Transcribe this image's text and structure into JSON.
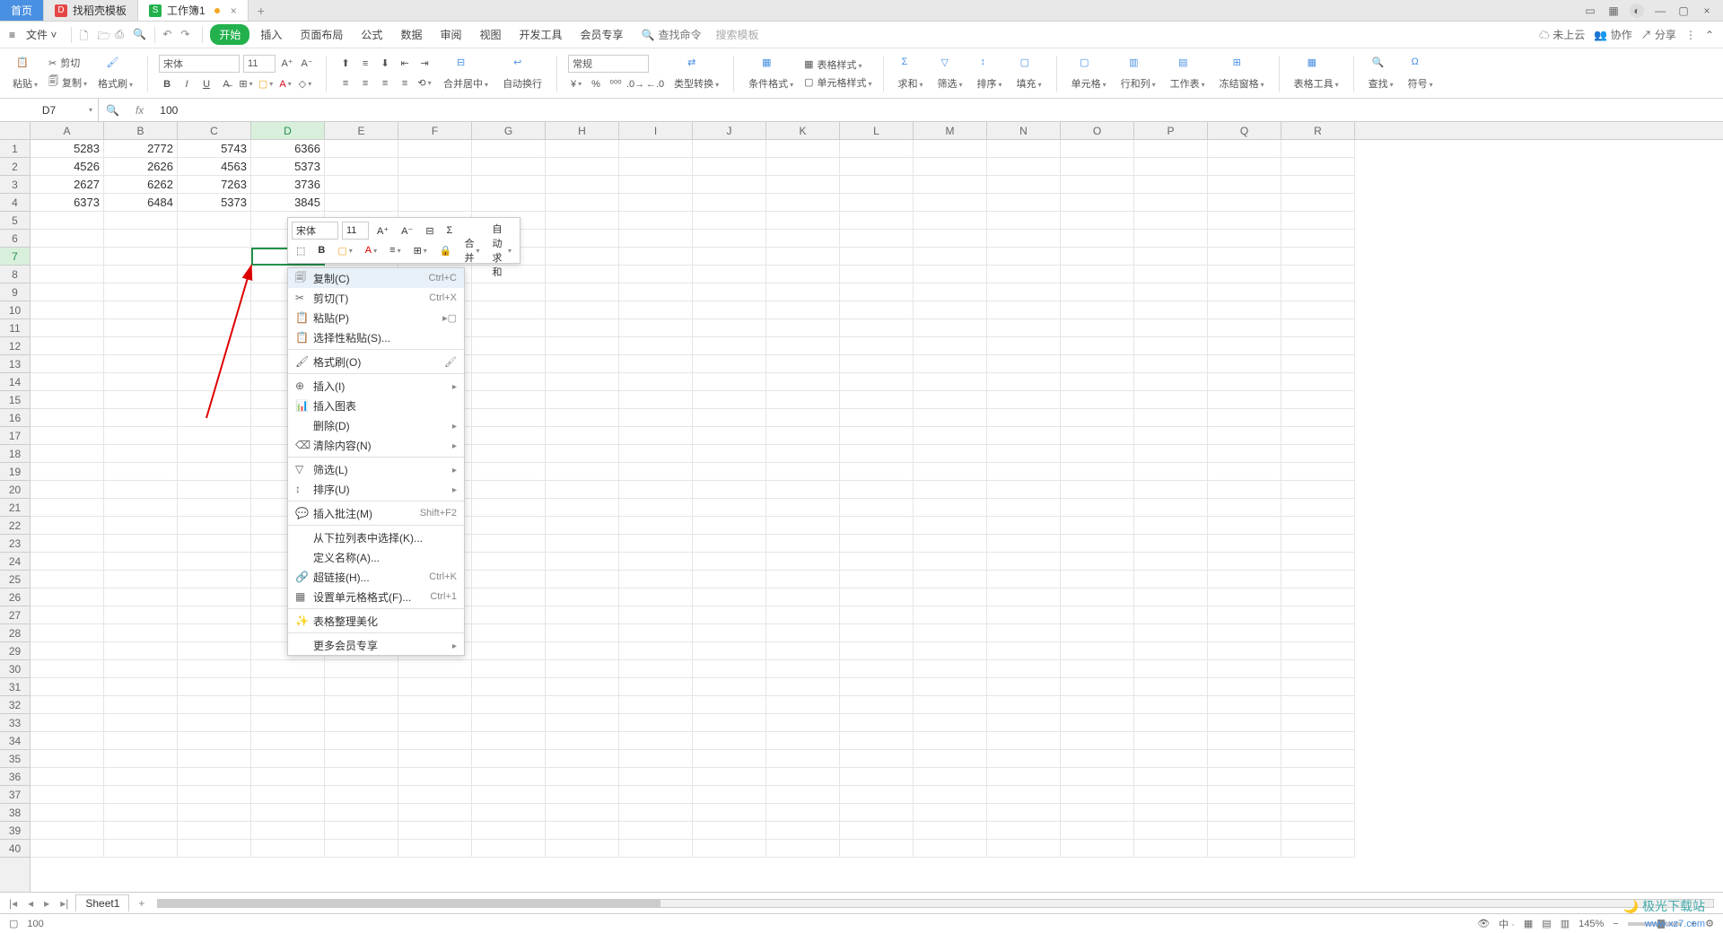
{
  "titlebar": {
    "home_tab": "首页",
    "tab2": "找稻壳模板",
    "tab3": "工作簿1"
  },
  "menubar": {
    "file": "文件",
    "tabs": [
      "开始",
      "插入",
      "页面布局",
      "公式",
      "数据",
      "审阅",
      "视图",
      "开发工具",
      "会员专享"
    ],
    "search_placeholder": "查找命令",
    "search2": "搜索模板",
    "right": {
      "cloud": "未上云",
      "coop": "协作",
      "share": "分享"
    }
  },
  "ribbon": {
    "paste": "粘贴",
    "cut": "剪切",
    "copy": "复制",
    "format_painter": "格式刷",
    "font": "宋体",
    "font_size": "11",
    "merge": "合并居中",
    "wrap": "自动换行",
    "num_fmt": "常规",
    "type_convert": "类型转换",
    "cond_fmt": "条件格式",
    "table_style": "表格样式",
    "cell_style": "单元格样式",
    "sum": "求和",
    "filter": "筛选",
    "sort": "排序",
    "fill": "填充",
    "cell": "单元格",
    "rowcol": "行和列",
    "worksheet": "工作表",
    "freeze": "冻结窗格",
    "table_tool": "表格工具",
    "find": "查找",
    "symbol": "符号"
  },
  "namebox": "D7",
  "formula": "100",
  "columns": [
    "A",
    "B",
    "C",
    "D",
    "E",
    "F",
    "G",
    "H",
    "I",
    "J",
    "K",
    "L",
    "M",
    "N",
    "O",
    "P",
    "Q",
    "R"
  ],
  "chart_data": {
    "type": "table",
    "rows": [
      {
        "A": "5283",
        "B": "2772",
        "C": "5743",
        "D": "6366"
      },
      {
        "A": "4526",
        "B": "2626",
        "C": "4563",
        "D": "5373"
      },
      {
        "A": "2627",
        "B": "6262",
        "C": "7263",
        "D": "3736"
      },
      {
        "A": "6373",
        "B": "6484",
        "C": "5373",
        "D": "3845"
      },
      {},
      {},
      {
        "D": "100"
      }
    ]
  },
  "minitoolbar": {
    "font": "宋体",
    "size": "11",
    "merge": "合并",
    "autosum": "自动求和"
  },
  "contextmenu": {
    "copy": "复制(C)",
    "copy_sc": "Ctrl+C",
    "cut": "剪切(T)",
    "cut_sc": "Ctrl+X",
    "paste": "粘贴(P)",
    "paste_special": "选择性粘贴(S)...",
    "format_painter": "格式刷(O)",
    "insert": "插入(I)",
    "insert_chart": "插入图表",
    "delete": "删除(D)",
    "clear": "清除内容(N)",
    "filter": "筛选(L)",
    "sort": "排序(U)",
    "comment": "插入批注(M)",
    "comment_sc": "Shift+F2",
    "dropdown": "从下拉列表中选择(K)...",
    "define_name": "定义名称(A)...",
    "hyperlink": "超链接(H)...",
    "hyperlink_sc": "Ctrl+K",
    "format_cells": "设置单元格格式(F)...",
    "format_cells_sc": "Ctrl+1",
    "table_beauty": "表格整理美化",
    "more_member": "更多会员专享"
  },
  "sheettabs": {
    "sheet1": "Sheet1"
  },
  "statusbar": {
    "val": "100",
    "zoom": "145%"
  },
  "watermark": {
    "brand": "极光下载站",
    "url": "www.xz7.com"
  }
}
